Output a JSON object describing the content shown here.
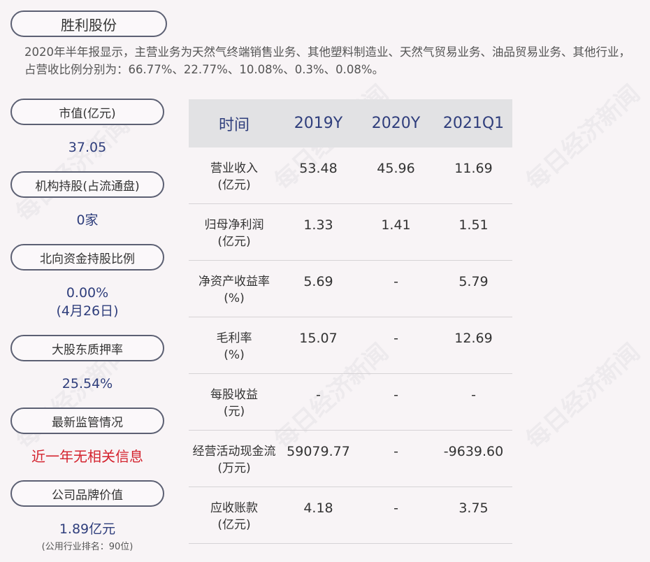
{
  "company_title": "胜利股份",
  "intro": "2020年半年报显示，主营业务为天然气终端销售业务、其他塑料制造业、天然气贸易业务、油品贸易业务、其他行业，占营收比例分别为：66.77%、22.77%、10.08%、0.3%、0.08%。",
  "sidebar": {
    "market_cap": {
      "label": "市值(亿元)",
      "value": "37.05"
    },
    "institutional": {
      "label": "机构持股(占流通盘)",
      "value": "0家"
    },
    "northbound": {
      "label": "北向资金持股比例",
      "value": "0.00%",
      "date": "(4月26日)"
    },
    "pledge": {
      "label": "大股东质押率",
      "value": "25.54%"
    },
    "regulation": {
      "label": "最新监管情况",
      "value": "近一年无相关信息"
    },
    "brand": {
      "label": "公司品牌价值",
      "value": "1.89亿元",
      "note": "(公用行业排名：90位)"
    }
  },
  "table": {
    "headers": [
      "时间",
      "2019Y",
      "2020Y",
      "2021Q1"
    ],
    "rows": [
      {
        "label": "营业收入",
        "unit": "(亿元)",
        "values": [
          "53.48",
          "45.96",
          "11.69"
        ]
      },
      {
        "label": "归母净利润",
        "unit": "(亿元)",
        "values": [
          "1.33",
          "1.41",
          "1.51"
        ]
      },
      {
        "label": "净资产收益率",
        "unit": "(%)",
        "values": [
          "5.69",
          "-",
          "5.79"
        ]
      },
      {
        "label": "毛利率",
        "unit": "(%)",
        "values": [
          "15.07",
          "-",
          "12.69"
        ]
      },
      {
        "label": "每股收益",
        "unit": "(元)",
        "values": [
          "-",
          "-",
          "-"
        ]
      },
      {
        "label": "经营活动现金流",
        "unit": "(万元)",
        "values": [
          "59079.77",
          "-",
          "-9639.60"
        ]
      },
      {
        "label": "应收账款",
        "unit": "(亿元)",
        "values": [
          "4.18",
          "-",
          "3.75"
        ]
      }
    ]
  },
  "watermark": "每日经济新闻"
}
